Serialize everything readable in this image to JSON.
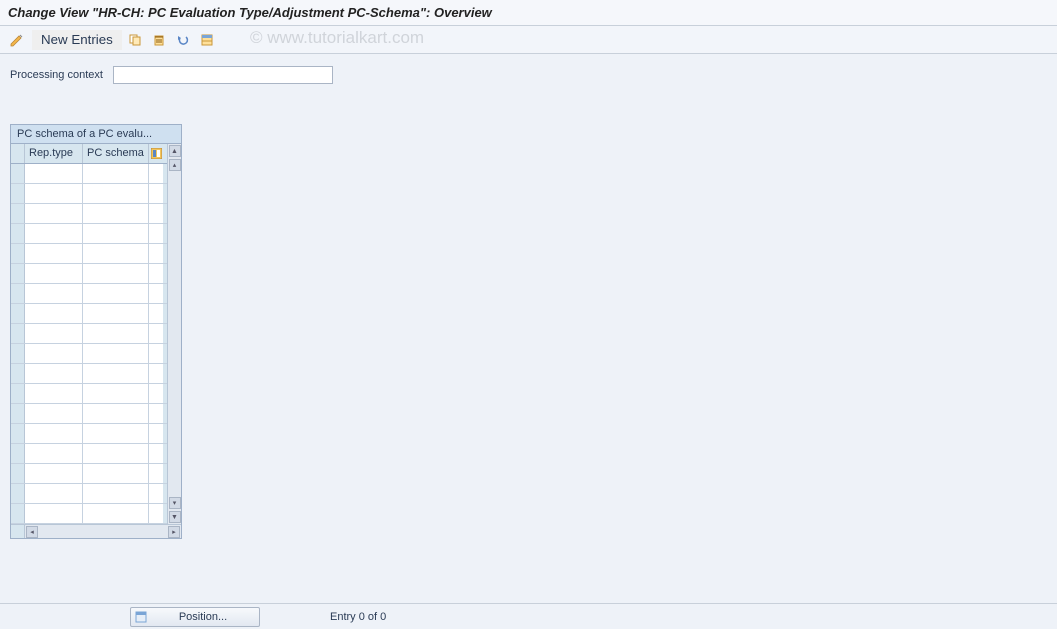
{
  "header": {
    "title": "Change View \"HR-CH: PC Evaluation Type/Adjustment PC-Schema\": Overview"
  },
  "toolbar": {
    "new_entries_label": "New Entries"
  },
  "watermark": "© www.tutorialkart.com",
  "form": {
    "processing_context_label": "Processing context",
    "processing_context_value": ""
  },
  "table": {
    "title": "PC schema of a PC evalu...",
    "columns": [
      "Rep.type",
      "PC schema"
    ],
    "rows": [
      [
        "",
        ""
      ],
      [
        "",
        ""
      ],
      [
        "",
        ""
      ],
      [
        "",
        ""
      ],
      [
        "",
        ""
      ],
      [
        "",
        ""
      ],
      [
        "",
        ""
      ],
      [
        "",
        ""
      ],
      [
        "",
        ""
      ],
      [
        "",
        ""
      ],
      [
        "",
        ""
      ],
      [
        "",
        ""
      ],
      [
        "",
        ""
      ],
      [
        "",
        ""
      ],
      [
        "",
        ""
      ],
      [
        "",
        ""
      ],
      [
        "",
        ""
      ],
      [
        "",
        ""
      ]
    ]
  },
  "footer": {
    "position_label": "Position...",
    "entry_text": "Entry 0 of 0"
  }
}
